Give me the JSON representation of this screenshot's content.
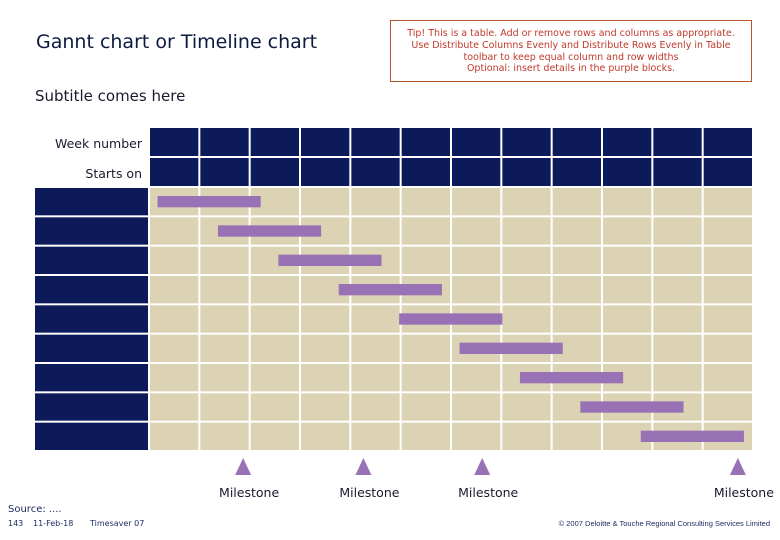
{
  "header": {
    "title": "Gannt chart or Timeline chart",
    "subtitle": "Subtitle comes here"
  },
  "tip": {
    "lines": [
      "Tip! This is a table. Add or remove rows and columns as appropriate.",
      "Use Distribute Columns Evenly and Distribute Rows Evenly in Table",
      "toolbar to keep equal column and row widths",
      "Optional: insert details in the purple blocks."
    ]
  },
  "colors": {
    "navy": "#0c1a5a",
    "grid_bg": "#dcd3b5",
    "bar": "#9872b4",
    "milestone": "#9872b4",
    "tip_text": "#c0392b",
    "tip_border": "#b5562e"
  },
  "chart_data": {
    "type": "gantt",
    "row_header_labels": [
      "Week number",
      "Starts on"
    ],
    "week_count": 12,
    "week_numbers": [
      "",
      "",
      "",
      "",
      "",
      "",
      "",
      "",
      "",
      "",
      "",
      ""
    ],
    "week_start_dates": [
      "",
      "",
      "",
      "",
      "",
      "",
      "",
      "",
      "",
      "",
      "",
      ""
    ],
    "tasks": [
      {
        "label": "",
        "start_week": 0.15,
        "duration_weeks": 2.05
      },
      {
        "label": "",
        "start_week": 1.35,
        "duration_weeks": 2.05
      },
      {
        "label": "",
        "start_week": 2.55,
        "duration_weeks": 2.05
      },
      {
        "label": "",
        "start_week": 3.75,
        "duration_weeks": 2.05
      },
      {
        "label": "",
        "start_week": 4.95,
        "duration_weeks": 2.05
      },
      {
        "label": "",
        "start_week": 6.15,
        "duration_weeks": 2.05
      },
      {
        "label": "",
        "start_week": 7.35,
        "duration_weeks": 2.05
      },
      {
        "label": "",
        "start_week": 8.55,
        "duration_weeks": 2.05
      },
      {
        "label": "",
        "start_week": 9.75,
        "duration_weeks": 2.05
      }
    ],
    "milestones": [
      {
        "label": "Milestone",
        "week": 1.85
      },
      {
        "label": "Milestone",
        "week": 4.24
      },
      {
        "label": "Milestone",
        "week": 6.6
      },
      {
        "label": "Milestone",
        "week": 11.68
      }
    ]
  },
  "footer": {
    "source": "Source: ....",
    "page_number": "143",
    "date": "11-Feb-18",
    "template": "Timesaver 07",
    "copyright": "© 2007 Deloitte & Touche Regional Consulting Services Limited"
  }
}
